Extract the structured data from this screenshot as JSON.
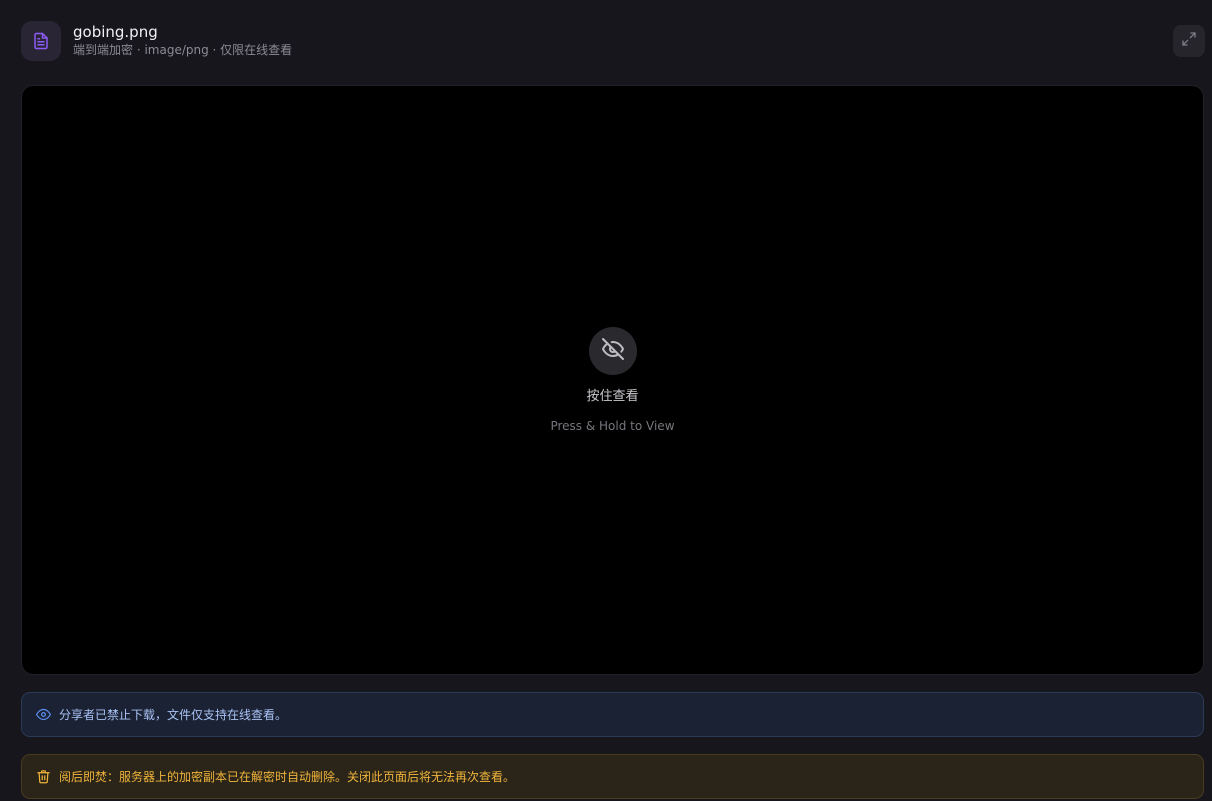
{
  "header": {
    "file_name": "gobing.png",
    "file_meta": "端到端加密 · image/png · 仅限在线查看",
    "file_icon": "document-icon",
    "expand_icon": "expand-icon"
  },
  "viewer": {
    "hidden_icon": "eye-off-icon",
    "hold_label_zh": "按住查看",
    "hold_label_en": "Press & Hold to View"
  },
  "notices": {
    "download_disabled": {
      "icon": "eye-icon",
      "text": "分享者已禁止下载，文件仅支持在线查看。",
      "color": "#5b8def"
    },
    "burn_after_reading": {
      "icon": "trash-icon",
      "text": "阅后即焚：服务器上的加密副本已在解密时自动删除。关闭此页面后将无法再次查看。",
      "color": "#f0b43a"
    }
  },
  "colors": {
    "accent": "#8b5cf6",
    "background": "#17161c"
  }
}
